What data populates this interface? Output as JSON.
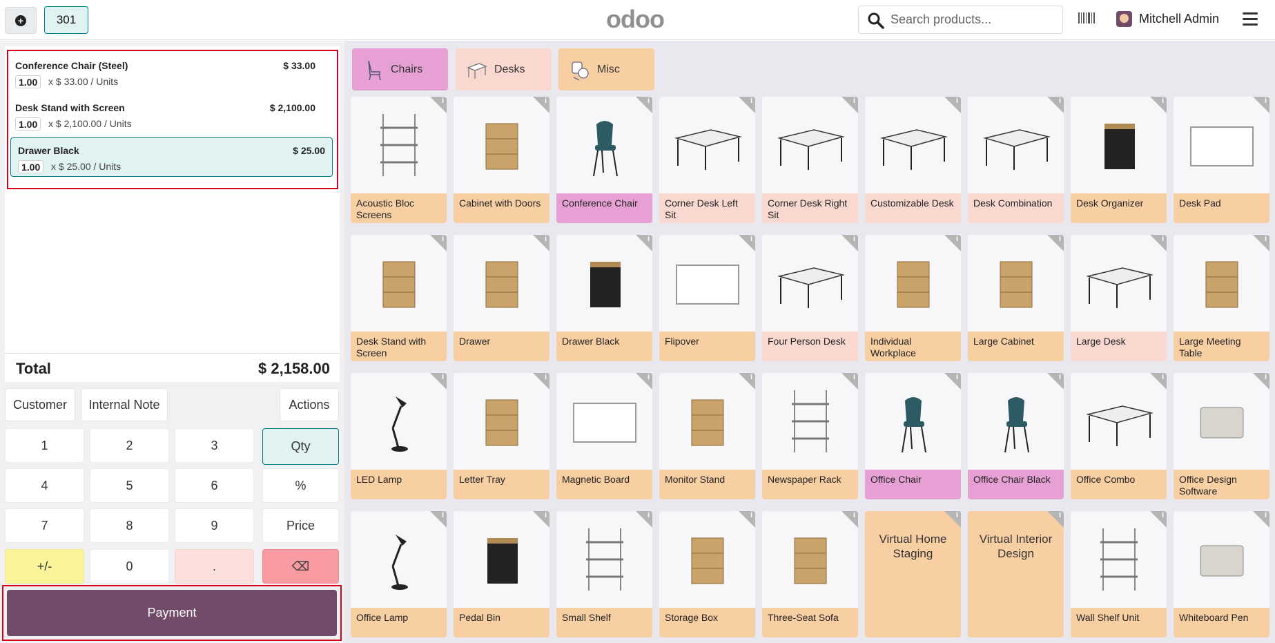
{
  "colors": {
    "brand": "#714b67",
    "accent": "#017e84",
    "chairs": "#e6a0d3",
    "desks": "#f9d8d0",
    "misc": "#f8cfa3"
  },
  "header": {
    "order_number": "301",
    "logo": "odoo",
    "search_placeholder": "Search products...",
    "user_name": "Mitchell Admin",
    "icons": {
      "new_order": "plus-circle-icon",
      "search": "search-icon",
      "barcode": "barcode-icon",
      "menu": "hamburger-icon"
    }
  },
  "order": {
    "lines": [
      {
        "name": "Conference Chair (Steel)",
        "price": "$ 33.00",
        "qty": "1.00",
        "unit": "x $ 33.00 / Units",
        "selected": false
      },
      {
        "name": "Desk Stand with Screen",
        "price": "$ 2,100.00",
        "qty": "1.00",
        "unit": "x $ 2,100.00 / Units",
        "selected": false
      },
      {
        "name": "Drawer Black",
        "price": "$ 25.00",
        "qty": "1.00",
        "unit": "x $ 25.00 / Units",
        "selected": true
      }
    ],
    "total_label": "Total",
    "total_value": "$ 2,158.00"
  },
  "controls": {
    "customer": "Customer",
    "internal_note": "Internal Note",
    "actions": "Actions"
  },
  "numpad": {
    "k1": "1",
    "k2": "2",
    "k3": "3",
    "k4": "4",
    "k5": "5",
    "k6": "6",
    "k7": "7",
    "k8": "8",
    "k9": "9",
    "k0": "0",
    "sign": "+/-",
    "dot": ".",
    "backspace": "⌫",
    "qty": "Qty",
    "percent": "%",
    "price": "Price"
  },
  "payment": {
    "label": "Payment"
  },
  "categories": [
    {
      "label": "Chairs",
      "icon": "chair-icon"
    },
    {
      "label": "Desks",
      "icon": "desk-icon"
    },
    {
      "label": "Misc",
      "icon": "misc-icon"
    }
  ],
  "products": [
    {
      "name": "Acoustic Bloc Screens",
      "cat": "misc"
    },
    {
      "name": "Cabinet with Doors",
      "cat": "misc"
    },
    {
      "name": "Conference Chair",
      "cat": "chairs"
    },
    {
      "name": "Corner Desk Left Sit",
      "cat": "desks"
    },
    {
      "name": "Corner Desk Right Sit",
      "cat": "desks"
    },
    {
      "name": "Customizable Desk",
      "cat": "desks"
    },
    {
      "name": "Desk Combination",
      "cat": "desks"
    },
    {
      "name": "Desk Organizer",
      "cat": "misc"
    },
    {
      "name": "Desk Pad",
      "cat": "misc"
    },
    {
      "name": "Desk Stand with Screen",
      "cat": "misc"
    },
    {
      "name": "Drawer",
      "cat": "misc"
    },
    {
      "name": "Drawer Black",
      "cat": "misc"
    },
    {
      "name": "Flipover",
      "cat": "misc"
    },
    {
      "name": "Four Person Desk",
      "cat": "desks"
    },
    {
      "name": "Individual Workplace",
      "cat": "misc"
    },
    {
      "name": "Large Cabinet",
      "cat": "misc"
    },
    {
      "name": "Large Desk",
      "cat": "desks"
    },
    {
      "name": "Large Meeting Table",
      "cat": "misc"
    },
    {
      "name": "LED Lamp",
      "cat": "misc"
    },
    {
      "name": "Letter Tray",
      "cat": "misc"
    },
    {
      "name": "Magnetic Board",
      "cat": "misc"
    },
    {
      "name": "Monitor Stand",
      "cat": "misc"
    },
    {
      "name": "Newspaper Rack",
      "cat": "misc"
    },
    {
      "name": "Office Chair",
      "cat": "chairs"
    },
    {
      "name": "Office Chair Black",
      "cat": "chairs"
    },
    {
      "name": "Office Combo",
      "cat": "misc"
    },
    {
      "name": "Office Design Software",
      "cat": "misc"
    },
    {
      "name": "Office Lamp",
      "cat": "misc"
    },
    {
      "name": "Pedal Bin",
      "cat": "misc"
    },
    {
      "name": "Small Shelf",
      "cat": "misc"
    },
    {
      "name": "Storage Box",
      "cat": "misc"
    },
    {
      "name": "Three-Seat Sofa",
      "cat": "misc"
    },
    {
      "name": "Virtual Home Staging",
      "cat": "misc",
      "text_only": true
    },
    {
      "name": "Virtual Interior Design",
      "cat": "misc",
      "text_only": true
    },
    {
      "name": "Wall Shelf Unit",
      "cat": "misc"
    },
    {
      "name": "Whiteboard Pen",
      "cat": "misc"
    }
  ]
}
